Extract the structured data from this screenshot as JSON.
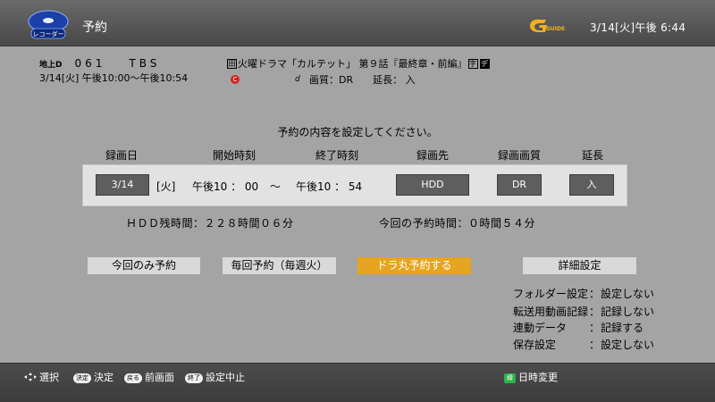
{
  "header": {
    "app_icon_label": "レコーダー",
    "title": "予約",
    "guide_logo": "GUIDE",
    "clock": "3/14[火]午後 6:44"
  },
  "program": {
    "channel_type": "地上D",
    "channel_number": "061",
    "channel_name": "TBS",
    "time": "3/14[火] 午後10:00〜午後10:54",
    "badge_left": "田",
    "title": "火曜ドラマ「カルテット」 第９話『最終章・前編』",
    "badge_right_1": "字",
    "badge_right_2": "デ",
    "c_icon": "C",
    "hd_icon": "d",
    "quality": "画質：DR",
    "extend": "延長：  入"
  },
  "instruction": "予約の内容を設定してください。",
  "columns": {
    "date": "録画日",
    "start": "開始時刻",
    "end": "終了時刻",
    "dest": "録画先",
    "quality": "録画画質",
    "extend": "延長"
  },
  "fields": {
    "date": "3/14",
    "weekday": "[火]",
    "start": "午後10 ： 00",
    "tilde": "〜",
    "end": "午後10 ： 54",
    "dest": "HDD",
    "quality": "DR",
    "extend": "入"
  },
  "info": {
    "hdd_remaining": "ＨＤＤ残時間：２２８時間０６分",
    "this_time": "今回の予約時間：０時間５４分"
  },
  "actions": {
    "once": "今回のみ予約",
    "weekly": "毎回予約（毎週火）",
    "dora": "ドラ丸予約する",
    "detail": "詳細設定"
  },
  "settings": [
    {
      "label": "フォルダー設定",
      "value": "設定しない"
    },
    {
      "label": "転送用動画記録",
      "value": "記録しない"
    },
    {
      "label": "連動データ",
      "value": "記録する"
    },
    {
      "label": "保存設定",
      "value": "設定しない"
    }
  ],
  "footer": {
    "select": "選択",
    "decide_key": "決定",
    "decide": "決定",
    "back_key": "戻る",
    "back": "前画面",
    "end_key": "終了",
    "end": "設定中止",
    "green_key": "緑",
    "datetime": "日時変更"
  },
  "colors": {
    "accent": "#e6a520",
    "panel": "#a4a4a4",
    "field": "#5e5e5e"
  }
}
